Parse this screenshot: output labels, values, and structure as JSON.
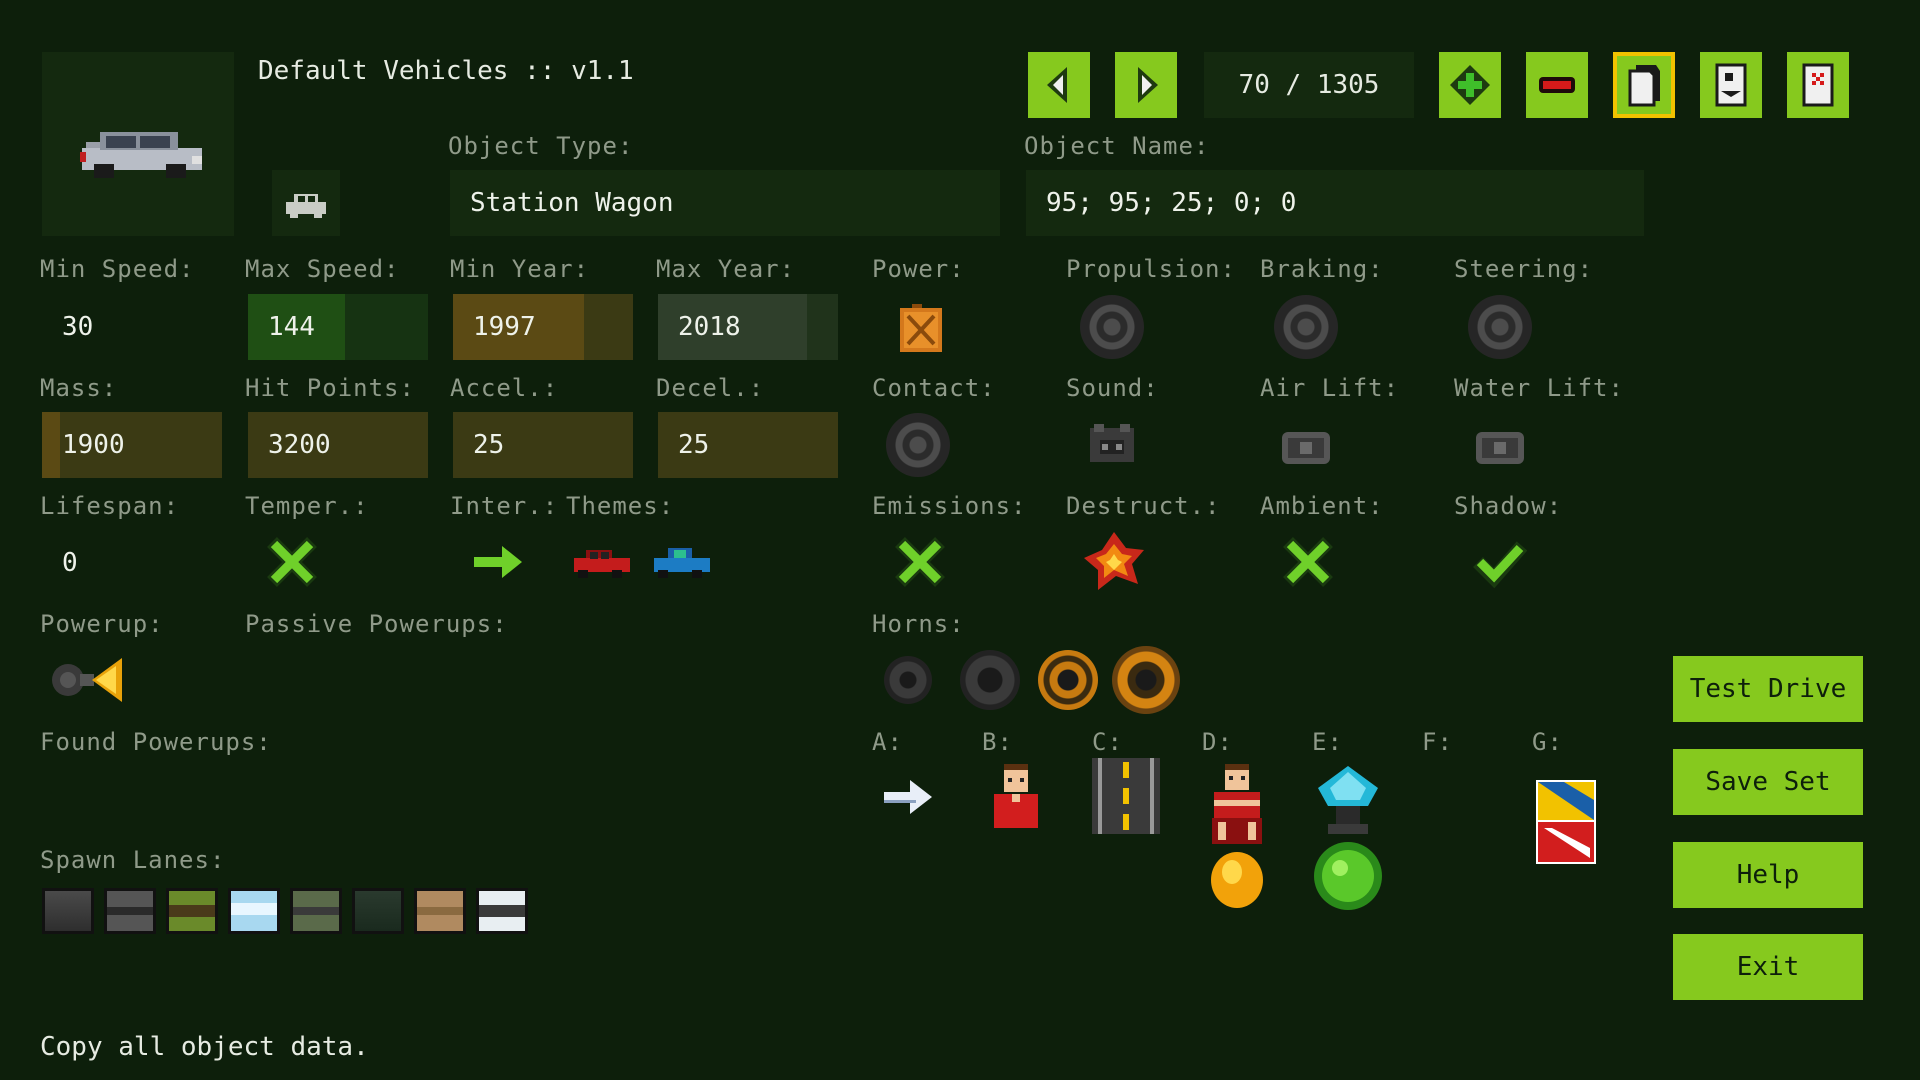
{
  "header": {
    "title": "Default Vehicles :: v1.1",
    "counter": "70 / 1305"
  },
  "object_type": {
    "label": "Object Type:",
    "value": "Station Wagon"
  },
  "object_name": {
    "label": "Object Name:",
    "value": "95; 95; 25; 0; 0"
  },
  "stats": {
    "min_speed": {
      "label": "Min Speed:",
      "value": "30"
    },
    "max_speed": {
      "label": "Max Speed:",
      "value": "144"
    },
    "min_year": {
      "label": "Min Year:",
      "value": "1997"
    },
    "max_year": {
      "label": "Max Year:",
      "value": "2018"
    },
    "mass": {
      "label": "Mass:",
      "value": "1900"
    },
    "hit_points": {
      "label": "Hit Points:",
      "value": "3200"
    },
    "accel": {
      "label": "Accel.:",
      "value": "25"
    },
    "decel": {
      "label": "Decel.:",
      "value": "25"
    },
    "lifespan": {
      "label": "Lifespan:",
      "value": "0"
    }
  },
  "labels": {
    "power": "Power:",
    "propulsion": "Propulsion:",
    "braking": "Braking:",
    "steering": "Steering:",
    "contact": "Contact:",
    "sound": "Sound:",
    "air_lift": "Air Lift:",
    "water_lift": "Water Lift:",
    "temper": "Temper.:",
    "inter": "Inter.:",
    "themes": "Themes:",
    "emissions": "Emissions:",
    "destruct": "Destruct.:",
    "ambient": "Ambient:",
    "shadow": "Shadow:",
    "powerup": "Powerup:",
    "passive_powerups": "Passive Powerups:",
    "horns": "Horns:",
    "found_powerups": "Found Powerups:",
    "spawn_lanes": "Spawn Lanes:",
    "slot_a": "A:",
    "slot_b": "B:",
    "slot_c": "C:",
    "slot_d": "D:",
    "slot_e": "E:",
    "slot_f": "F:",
    "slot_g": "G:"
  },
  "buttons": {
    "test_drive": "Test Drive",
    "save_set": "Save Set",
    "help": "Help",
    "exit": "Exit"
  },
  "status": "Copy all object data.",
  "icons": {
    "prev": "arrow-left-icon",
    "next": "arrow-right-icon",
    "add": "plus-icon",
    "remove": "minus-icon",
    "copy": "copy-icon",
    "paste": "paste-icon",
    "delete": "delete-icon"
  },
  "colors": {
    "background": "#0d1f0b",
    "panel": "#14290f",
    "accent": "#86c91e",
    "selected_outline": "#f2c200",
    "label": "#8f9a89"
  }
}
